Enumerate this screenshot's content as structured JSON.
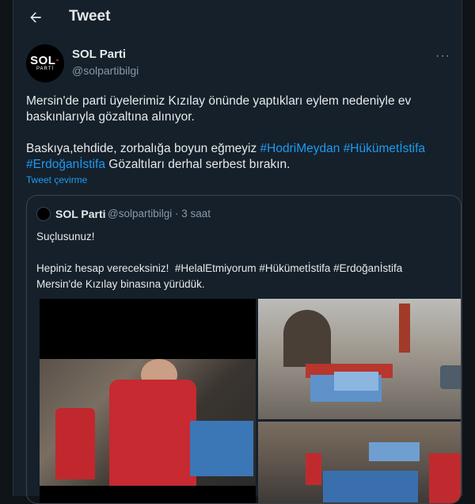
{
  "header": {
    "title": "Tweet"
  },
  "tweet": {
    "author_name": "SOL Parti",
    "author_handle": "@solpartibilgi",
    "avatar_text": "SOL",
    "avatar_subtext": "PARTİ",
    "text_line1": "Mersin'de parti üyelerimiz Kızılay önünde yaptıkları eylem nedeniyle ev baskınlarıyla gözaltına alınıyor.",
    "text_line2": "Baskıya,tehdide, zorbalığa boyun eğmeyiz ",
    "hashtag1": "#HodriMeydan",
    "hashtag2": "#Hükümetİstifa",
    "hashtag3": "#Erdoğanİstifa",
    "text_tail": " Gözaltıları derhal serbest bırakın.",
    "translate_label": "Tweet çevirme"
  },
  "quoted": {
    "author_name": "SOL Parti",
    "meta": "@solpartibilgi · 3 saat",
    "text": "Suçlusunuz!\n\nHepiniz hesap vereceksiniz!  #HelalEtmiyorum #Hükümetİstifa #Erdoğanİstifa\nMersin'de Kızılay binasına yürüdük."
  },
  "icons": {
    "back": "back-arrow-icon",
    "more": "more-icon"
  }
}
